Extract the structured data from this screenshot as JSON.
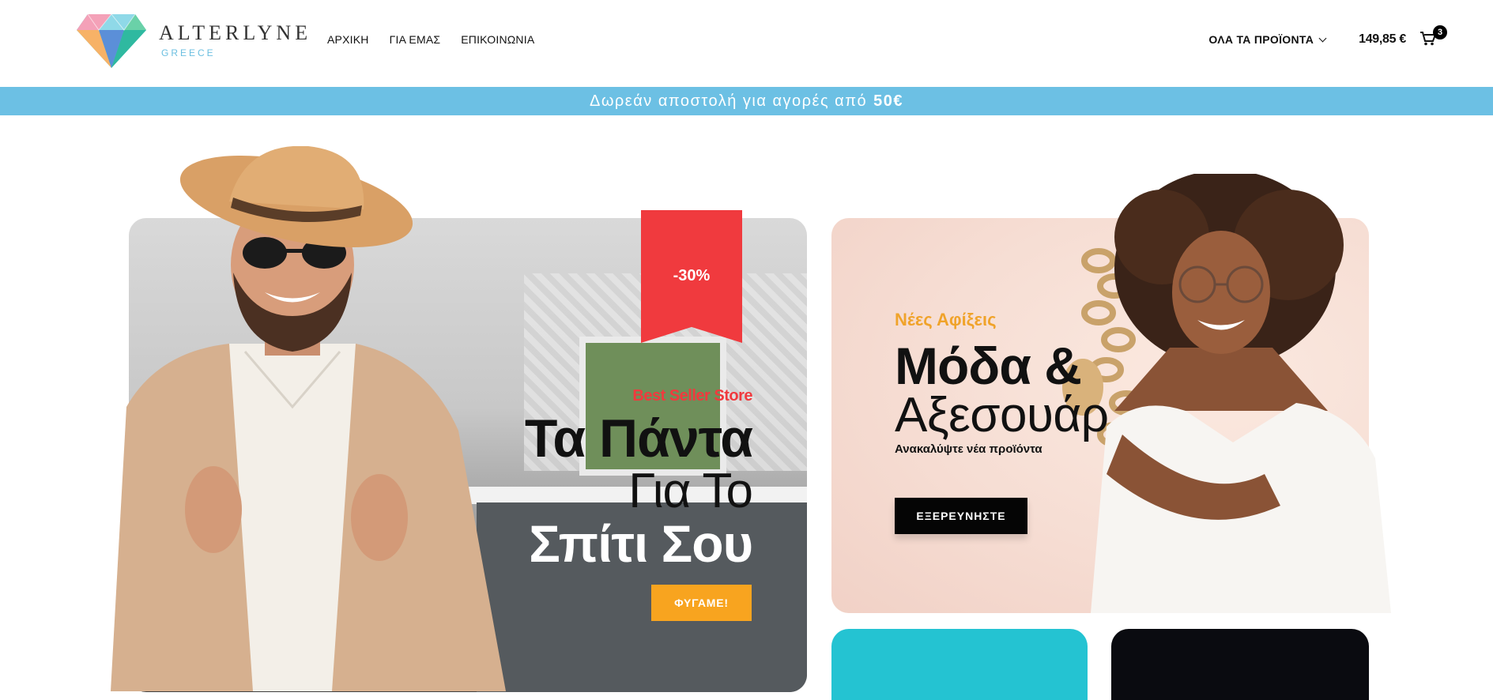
{
  "header": {
    "brand_name": "ALTERLYNE",
    "brand_sub": "GREECE",
    "nav": [
      "ΑΡΧΙΚΗ",
      "ΓΙΑ ΕΜΑΣ",
      "ΕΠΙΚΟΙΝΩΝΙΑ"
    ],
    "all_products": "ΟΛΑ ΤΑ ΠΡΟΪΟΝΤΑ",
    "cart_total": "149,85 €",
    "cart_count": "3",
    "cart_icon": "shopping-cart-icon"
  },
  "promo": {
    "text": "Δωρεάν αποστολή για αγορές από",
    "amount": "50€",
    "color": "#6cc0e4"
  },
  "hero_left": {
    "badge": "-30%",
    "kicker": "Best Seller Store",
    "line1": "Τα Πάντα",
    "line2": "Για Το",
    "line3": "Σπίτι Σου",
    "button": "ΦΥΓΑΜΕ!",
    "accent": "#f03a3e",
    "button_color": "#f8a41f"
  },
  "hero_right": {
    "kicker": "Νέες Αφίξεις",
    "line1": "Μόδα &",
    "line2": "Αξεσουάρ",
    "subtitle": "Ανακαλύψτε νέα προϊόντα",
    "button": "ΕΞΕΡΕΥΝΗΣΤΕ",
    "kicker_color": "#f0a32a"
  },
  "tiles": {
    "cyan": "#24c3d2",
    "dark": "#0a0b10"
  }
}
